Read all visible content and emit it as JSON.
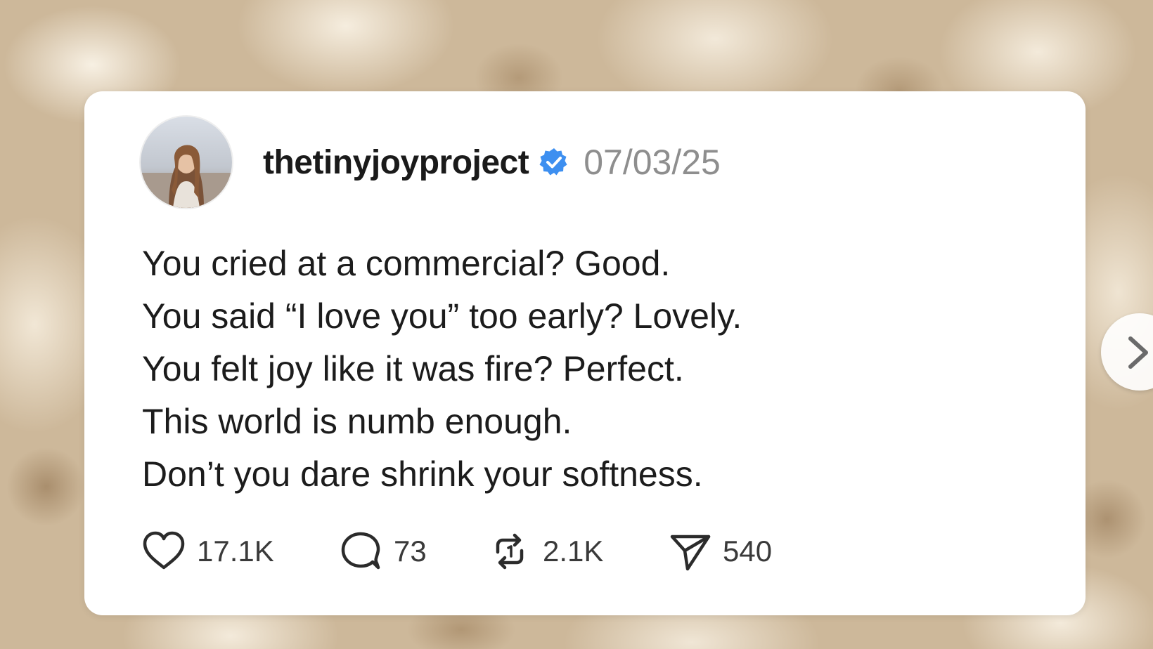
{
  "post": {
    "username": "thetinyjoyproject",
    "verified": true,
    "date": "07/03/25",
    "lines": [
      "You cried at a commercial? Good.",
      "You said “I love you” too early? Lovely.",
      "You felt joy like it was fire? Perfect.",
      "This world is numb enough.",
      "Don’t you dare shrink your softness."
    ],
    "stats": {
      "likes": "17.1K",
      "replies": "73",
      "reposts": "2.1K",
      "shares": "540"
    }
  },
  "icons": {
    "like": "heart-icon",
    "reply": "comment-icon",
    "repost": "repost-icon",
    "share": "send-icon",
    "verified": "verified-badge-icon",
    "next": "chevron-right-icon"
  },
  "colors": {
    "verified_badge": "#3d8ff0",
    "date_text": "#8e8e8e",
    "card_background": "#ffffff"
  }
}
